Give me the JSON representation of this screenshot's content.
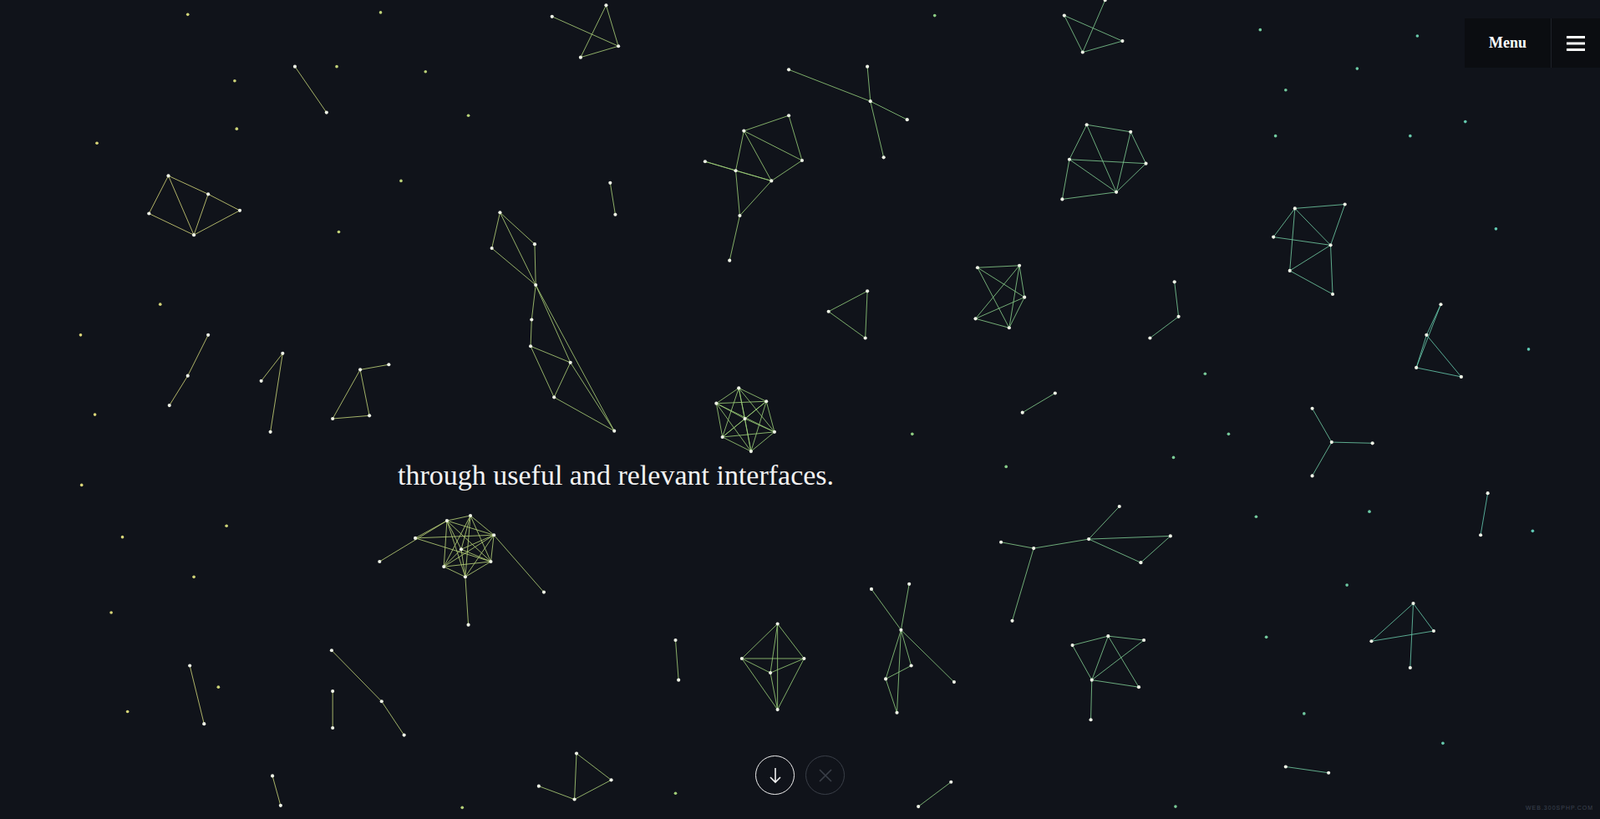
{
  "hero": {
    "text": "through useful and relevant interfaces."
  },
  "menu": {
    "label": "Menu"
  },
  "controls": [
    {
      "kind": "down",
      "disabled": false
    },
    {
      "kind": "close",
      "disabled": true
    }
  ],
  "watermark": "WEB.300SPHP.COM"
}
